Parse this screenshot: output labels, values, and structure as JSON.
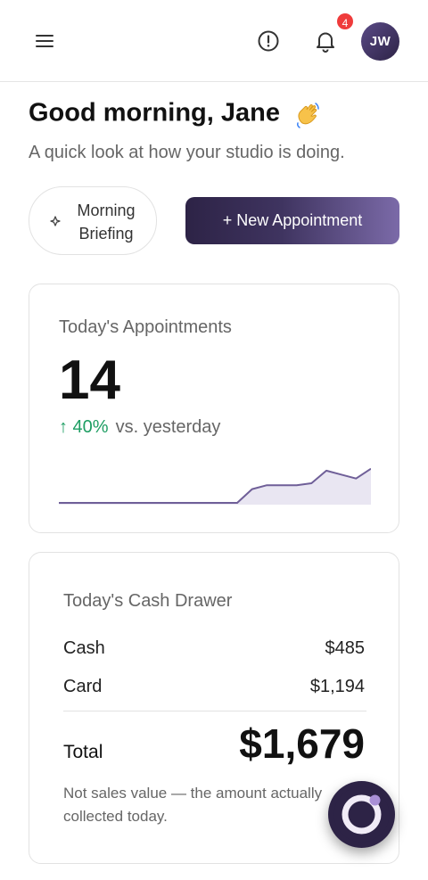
{
  "header": {
    "menu_icon": "hamburger-menu-icon",
    "alert_icon": "alert-circle-icon",
    "bell_icon": "bell-icon",
    "notification_count": "4",
    "avatar_initials": "JW"
  },
  "greeting": {
    "title": "Good morning, Jane",
    "emoji_icon": "waving-hand-icon",
    "subtitle": "A quick look at how your studio is doing."
  },
  "actions": {
    "briefing_line1": "Morning",
    "briefing_line2": "Briefing",
    "briefing_icon": "sparkle-icon",
    "new_appointment": "+ New Appointment"
  },
  "appointments": {
    "title": "Today's Appointments",
    "count": "14",
    "change": "↑ 40%",
    "comparison": "vs. yesterday",
    "trend_points": [
      0,
      0,
      0,
      0,
      0,
      0,
      0,
      0,
      0,
      0,
      0,
      0,
      0,
      0.35,
      0.45,
      0.45,
      0.45,
      0.5,
      0.82,
      0.72,
      0.62,
      0.87
    ]
  },
  "cash_drawer": {
    "title": "Today's Cash Drawer",
    "cash_label": "Cash",
    "cash_value": "$485",
    "card_label": "Card",
    "card_value": "$1,194",
    "total_label": "Total",
    "total_value": "$1,679",
    "note": "Not sales value — the amount actually collected today."
  },
  "colors": {
    "brand": "#2d2346",
    "accent": "#7b6aa8",
    "positive": "#1e9e63",
    "badge": "#ef3b3b"
  }
}
